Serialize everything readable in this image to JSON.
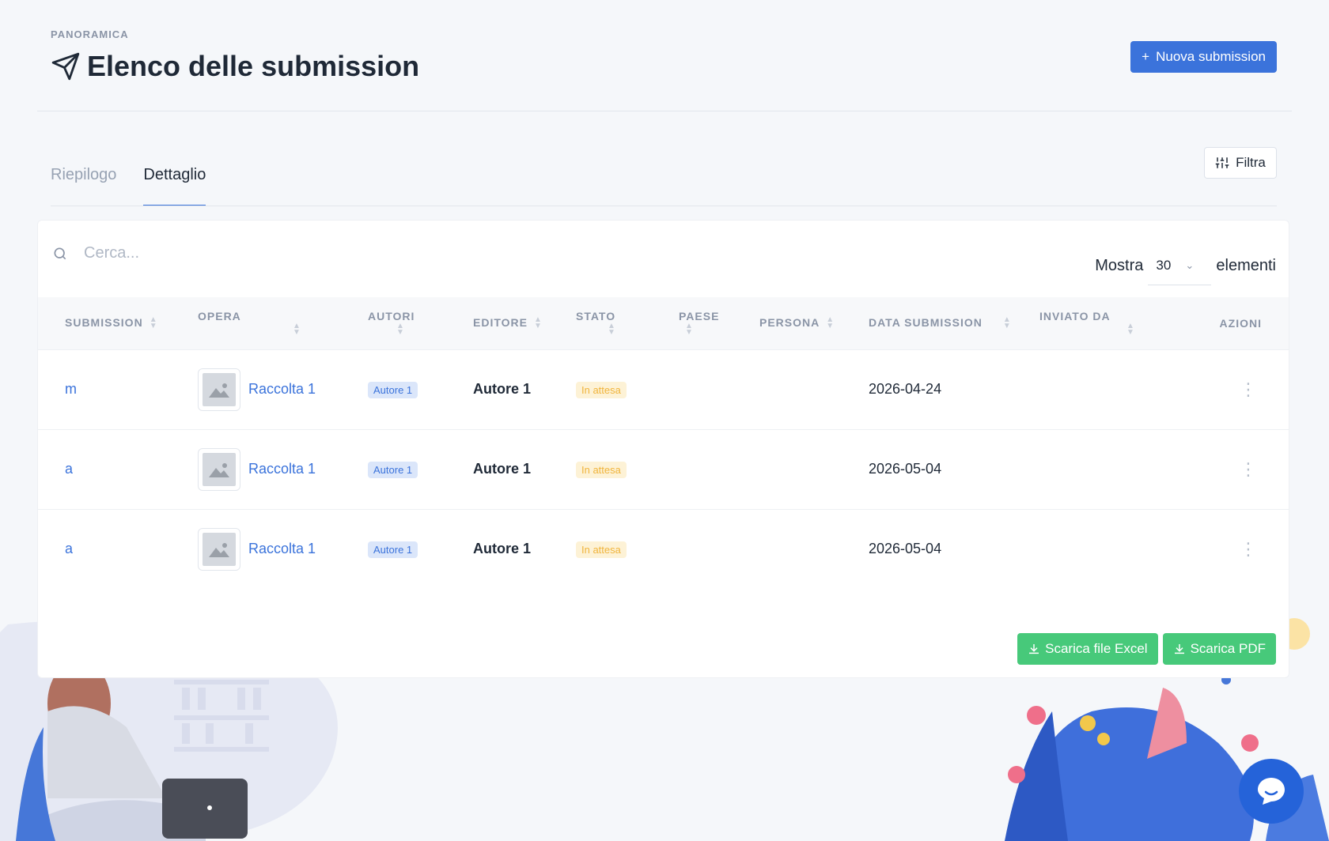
{
  "header": {
    "overline": "PANORAMICA",
    "title": "Elenco delle submission",
    "new_button": "Nuova submission"
  },
  "tabs": [
    {
      "label": "Riepilogo",
      "active": false
    },
    {
      "label": "Dettaglio",
      "active": true
    }
  ],
  "filter_button": "Filtra",
  "search": {
    "placeholder": "Cerca..."
  },
  "show": {
    "prefix": "Mostra",
    "value": "30",
    "suffix": "elementi"
  },
  "table": {
    "columns": [
      "SUBMISSION",
      "OPERA",
      "AUTORI",
      "EDITORE",
      "STATO",
      "PAESE",
      "PERSONA",
      "DATA SUBMISSION",
      "INVIATO DA",
      "AZIONI"
    ],
    "rows": [
      {
        "submission": "m",
        "opera": "Raccolta 1",
        "autori": "Autore 1",
        "editore": "Autore 1",
        "stato": "In attesa",
        "paese": "",
        "persona": "",
        "data": "2026-04-24",
        "inviato_da": ""
      },
      {
        "submission": "a",
        "opera": "Raccolta 1",
        "autori": "Autore 1",
        "editore": "Autore 1",
        "stato": "In attesa",
        "paese": "",
        "persona": "",
        "data": "2026-05-04",
        "inviato_da": ""
      },
      {
        "submission": "a",
        "opera": "Raccolta 1",
        "autori": "Autore 1",
        "editore": "Autore 1",
        "stato": "In attesa",
        "paese": "",
        "persona": "",
        "data": "2026-05-04",
        "inviato_da": ""
      }
    ]
  },
  "downloads": {
    "excel": "Scarica file Excel",
    "pdf": "Scarica PDF"
  },
  "colors": {
    "primary": "#3b73db",
    "success": "#47c97a",
    "warning": "#f0b43c",
    "chat": "#2563d9"
  }
}
